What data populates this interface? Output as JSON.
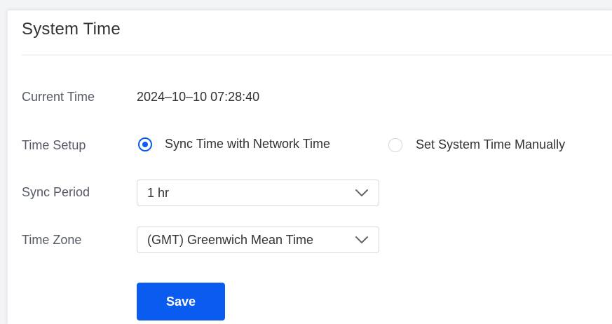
{
  "page": {
    "title": "System Time"
  },
  "form": {
    "current_time": {
      "label": "Current Time",
      "value": "2024–10–10 07:28:40"
    },
    "time_setup": {
      "label": "Time Setup",
      "options": [
        {
          "label": "Sync Time with Network Time",
          "checked": true
        },
        {
          "label": "Set System Time Manually",
          "checked": false
        }
      ]
    },
    "sync_period": {
      "label": "Sync Period",
      "selected": "1 hr",
      "icon": "chevron-down-icon"
    },
    "time_zone": {
      "label": "Time Zone",
      "selected": "(GMT) Greenwich Mean Time",
      "icon": "chevron-down-icon"
    },
    "save_label": "Save"
  },
  "colors": {
    "accent": "#0a5bf0",
    "label_text": "#555a66",
    "value_text": "#333333"
  }
}
